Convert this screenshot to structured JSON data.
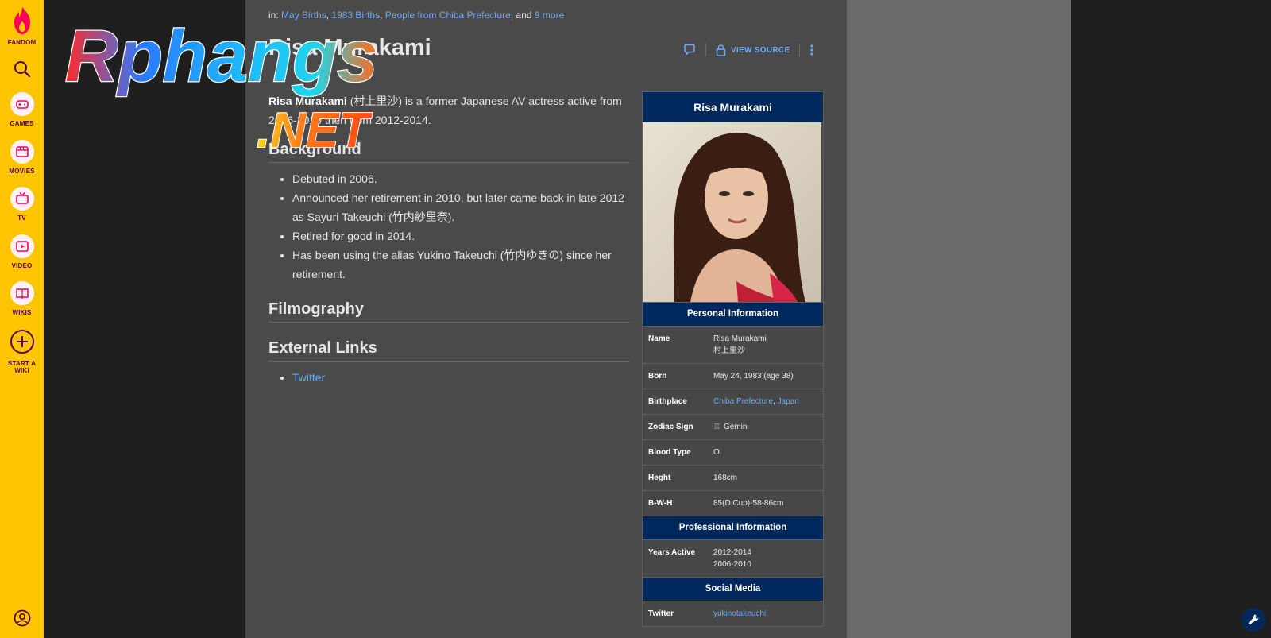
{
  "rail": {
    "logo_label": "FANDOM",
    "items": [
      {
        "label": "GAMES",
        "icon": "gamepad-icon"
      },
      {
        "label": "MOVIES",
        "icon": "film-icon"
      },
      {
        "label": "TV",
        "icon": "tv-icon"
      },
      {
        "label": "VIDEO",
        "icon": "video-play-icon"
      },
      {
        "label": "WIKIS",
        "icon": "book-icon"
      }
    ],
    "start_wiki_line1": "START A",
    "start_wiki_line2": "WIKI"
  },
  "categories": {
    "prefix": "in:",
    "links": [
      "May Births",
      "1983 Births",
      "People from Chiba Prefecture"
    ],
    "and_text": ", and",
    "more": "9 more"
  },
  "page": {
    "title": "Risa Murakami",
    "view_source": "VIEW SOURCE"
  },
  "watermark": {
    "line1": "Rphangs",
    "line2": ".NET"
  },
  "article": {
    "lead_bold": "Risa Murakami",
    "lead_native": " (村上里沙)",
    "lead_rest": " is a former Japanese AV actress active from 2006-2010 then from 2012-2014.",
    "sections": {
      "background": "Background",
      "filmography": "Filmography",
      "external_links": "External Links"
    },
    "background_items": [
      "Debuted in 2006.",
      "Announced her retirement in 2010, but later came back in late 2012 as Sayuri Takeuchi (竹内紗里奈).",
      "Retired for good in 2014.",
      "Has been using the alias Yukino Takeuchi (竹内ゆきの) since her retirement."
    ],
    "external_links": [
      "Twitter"
    ]
  },
  "infobox": {
    "title": "Risa Murakami",
    "personal_header": "Personal Information",
    "professional_header": "Professional Information",
    "social_header": "Social Media",
    "rows": {
      "name": {
        "label": "Name",
        "value1": "Risa Murakami",
        "value2": "村上里沙"
      },
      "born": {
        "label": "Born",
        "value": "May 24, 1983 (age 38)"
      },
      "birthplace": {
        "label": "Birthplace",
        "link1": "Chiba Prefecture",
        "sep": ", ",
        "link2": "Japan"
      },
      "zodiac": {
        "label": "Zodiac Sign",
        "value": "Gemini",
        "symbol": "♊"
      },
      "blood": {
        "label": "Blood Type",
        "value": "O"
      },
      "height": {
        "label": "Heght",
        "value": "168cm"
      },
      "bwh": {
        "label": "B-W-H",
        "value": "85(D Cup)-58-86cm"
      },
      "years_active": {
        "label": "Years Active",
        "value1": "2012-2014",
        "value2": "2006-2010"
      },
      "twitter": {
        "label": "Twitter",
        "value": "yukinotakeuchi"
      }
    }
  },
  "colors": {
    "rail": "#ffc500",
    "infobox_header": "#00285c",
    "link": "#6fa8f0",
    "content_bg": "#4a4a4a"
  }
}
